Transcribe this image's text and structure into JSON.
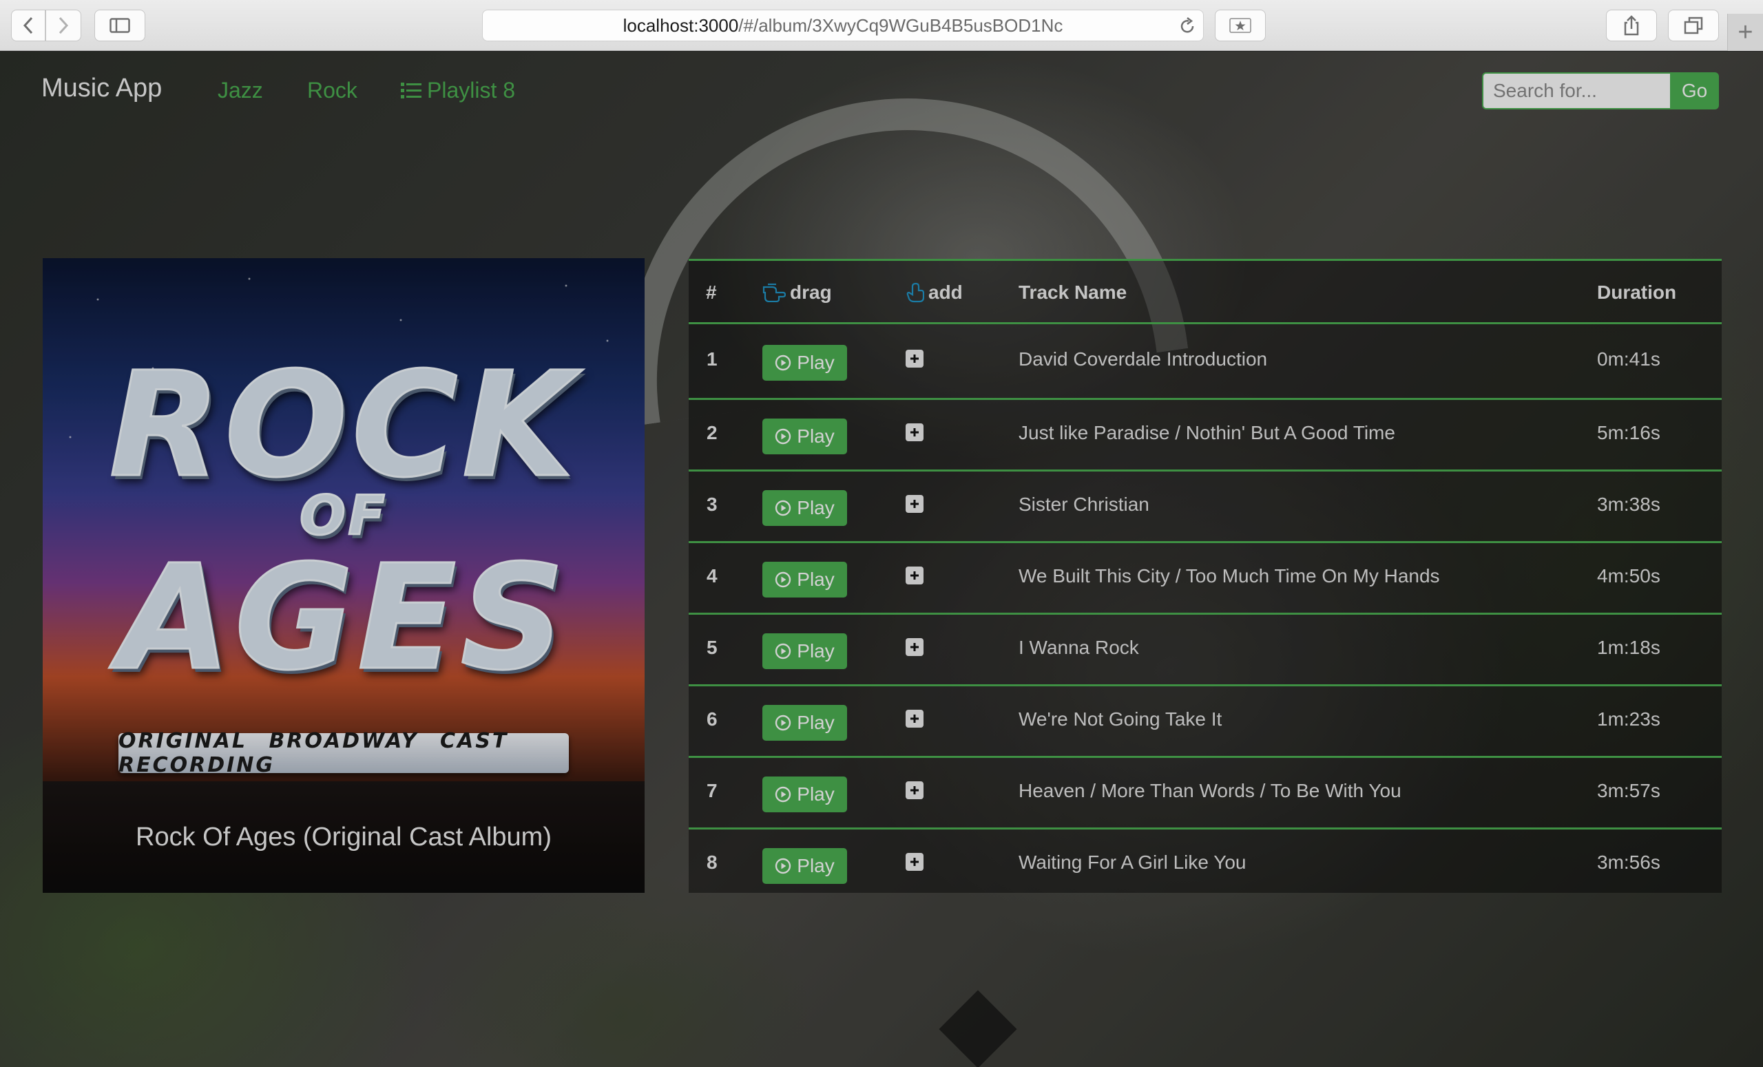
{
  "browser": {
    "url_host": "localhost:3000",
    "url_path": "/#/album/3XwyCq9WGuB4B5usBOD1Nc"
  },
  "navbar": {
    "brand": "Music App",
    "links": [
      "Jazz",
      "Rock"
    ],
    "playlist_label": "Playlist 8",
    "search_placeholder": "Search for...",
    "go_label": "Go"
  },
  "album": {
    "cover_title_top": "ROCK",
    "cover_title_mid": "OF",
    "cover_title_bottom": "AGES",
    "cover_banner": "ORIGINAL BROADWAY CAST RECORDING",
    "name": "Rock Of Ages (Original Cast Album)"
  },
  "table": {
    "headers": {
      "num": "#",
      "drag": "drag",
      "add": "add",
      "track_name": "Track Name",
      "duration": "Duration"
    },
    "play_label": "Play",
    "rows": [
      {
        "num": "1",
        "name": "David Coverdale Introduction",
        "duration": "0m:41s"
      },
      {
        "num": "2",
        "name": "Just like Paradise / Nothin' But A Good Time",
        "duration": "5m:16s"
      },
      {
        "num": "3",
        "name": "Sister Christian",
        "duration": "3m:38s"
      },
      {
        "num": "4",
        "name": "We Built This City / Too Much Time On My Hands",
        "duration": "4m:50s"
      },
      {
        "num": "5",
        "name": "I Wanna Rock",
        "duration": "1m:18s"
      },
      {
        "num": "6",
        "name": "We're Not Going Take It",
        "duration": "1m:23s"
      },
      {
        "num": "7",
        "name": "Heaven / More Than Words / To Be With You",
        "duration": "3m:57s"
      },
      {
        "num": "8",
        "name": "Waiting For A Girl Like You",
        "duration": "3m:56s"
      }
    ]
  },
  "colors": {
    "accent": "#4cb052",
    "text": "#e7e7e7"
  }
}
